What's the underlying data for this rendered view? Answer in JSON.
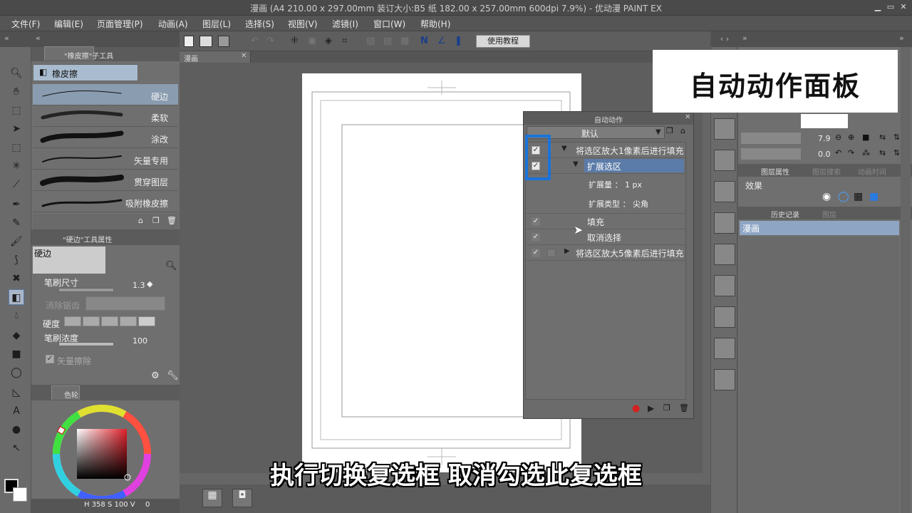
{
  "window": {
    "title": "漫画 (A4 210.00 x 297.00mm 装订大小:B5 纸 182.00 x 257.00mm 600dpi 7.9%) - 优动漫 PAINT EX"
  },
  "menu": {
    "items": [
      "文件(F)",
      "编辑(E)",
      "页面管理(P)",
      "动画(A)",
      "图层(L)",
      "选择(S)",
      "视图(V)",
      "滤镜(I)",
      "窗口(W)",
      "帮助(H)"
    ]
  },
  "toolbar": {
    "tutorial_label": "使用教程"
  },
  "canvas_tab": {
    "label": "漫画"
  },
  "subtool_panel": {
    "title": "\"橡皮擦\"子工具",
    "group_label": "橡皮擦",
    "items": [
      "硬边",
      "柔软",
      "涂改",
      "矢量专用",
      "贯穿图层",
      "吸附橡皮擦"
    ]
  },
  "tool_property": {
    "title": "\"硬边\"工具属性",
    "preview_label": "硬边",
    "brush_size_label": "笔刷尺寸",
    "brush_size_value": "1.3",
    "clear_label": "消除锯齿",
    "hardness_label": "硬度",
    "density_label": "笔刷浓度",
    "density_value": "100",
    "vector_erase_label": "矢量擦除"
  },
  "color_panel": {
    "tab_label": "色轮",
    "readout": "H 358 S 100 V",
    "v_value": "0"
  },
  "auto_action": {
    "title": "自动动作",
    "set_name": "默认",
    "rows": [
      {
        "label": "将选区放大1像素后进行填充",
        "checked": true
      },
      {
        "label": "扩展选区",
        "checked": true
      },
      {
        "label": "扩展量 ： 1 px"
      },
      {
        "label": "扩展类型 ： 尖角"
      },
      {
        "label": "填充",
        "checked": true
      },
      {
        "label": "取消选择",
        "checked": true
      },
      {
        "label": "将选区放大5像素后进行填充",
        "checked": true
      }
    ]
  },
  "right_panel": {
    "zoom_value": "7.9",
    "rotate_value": "0.0",
    "layer_prop_tab": "图层属性",
    "layer_tab_2": "图层搜索",
    "layer_tab_3": "动画时间",
    "effect_label": "效果",
    "history_tab": "历史记录",
    "history_tab_2": "图层",
    "history_item": "漫画"
  },
  "overlay": {
    "title": "自动动作面板",
    "subtitle": "执行切换复选框 取消勾选此复选框"
  },
  "colors": {
    "accent_blue": "#1a73d9",
    "selection_blue": "#4a6a9a",
    "record_red": "#d42020"
  }
}
